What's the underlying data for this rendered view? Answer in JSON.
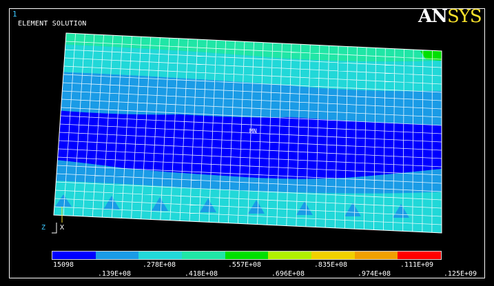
{
  "window": {
    "number": "1",
    "title": "ELEMENT SOLUTION"
  },
  "logo": {
    "part1": "AN",
    "part2": "SYS"
  },
  "plot": {
    "mn_label": "MN",
    "triad": {
      "z": "Z",
      "x": "X"
    }
  },
  "colors": {
    "background": "#000000",
    "frame": "#ffffff",
    "mesh": "#ffffff",
    "logo_accent": "#f7e02b"
  },
  "legend": {
    "colors": [
      "#0000ff",
      "#1a9be6",
      "#21d8d8",
      "#20e6a6",
      "#00e000",
      "#b0f000",
      "#f0d000",
      "#f0a000",
      "#ff0000"
    ],
    "labels_top": [
      "15098",
      ".278E+08",
      ".557E+08",
      ".835E+08",
      ".111E+09"
    ],
    "labels_bottom": [
      ".139E+08",
      ".418E+08",
      ".696E+08",
      ".974E+08",
      ".125E+09"
    ]
  },
  "contour_bands": [
    {
      "name": "top-green-band",
      "color": "#20e6a6"
    },
    {
      "name": "upper-cyan-band",
      "color": "#21d8d8"
    },
    {
      "name": "upper-blue-band",
      "color": "#1a9be6"
    },
    {
      "name": "min-band",
      "color": "#0000ff"
    },
    {
      "name": "lower-blue-band",
      "color": "#1a9be6"
    },
    {
      "name": "lower-cyan-band",
      "color": "#21d8d8"
    }
  ]
}
